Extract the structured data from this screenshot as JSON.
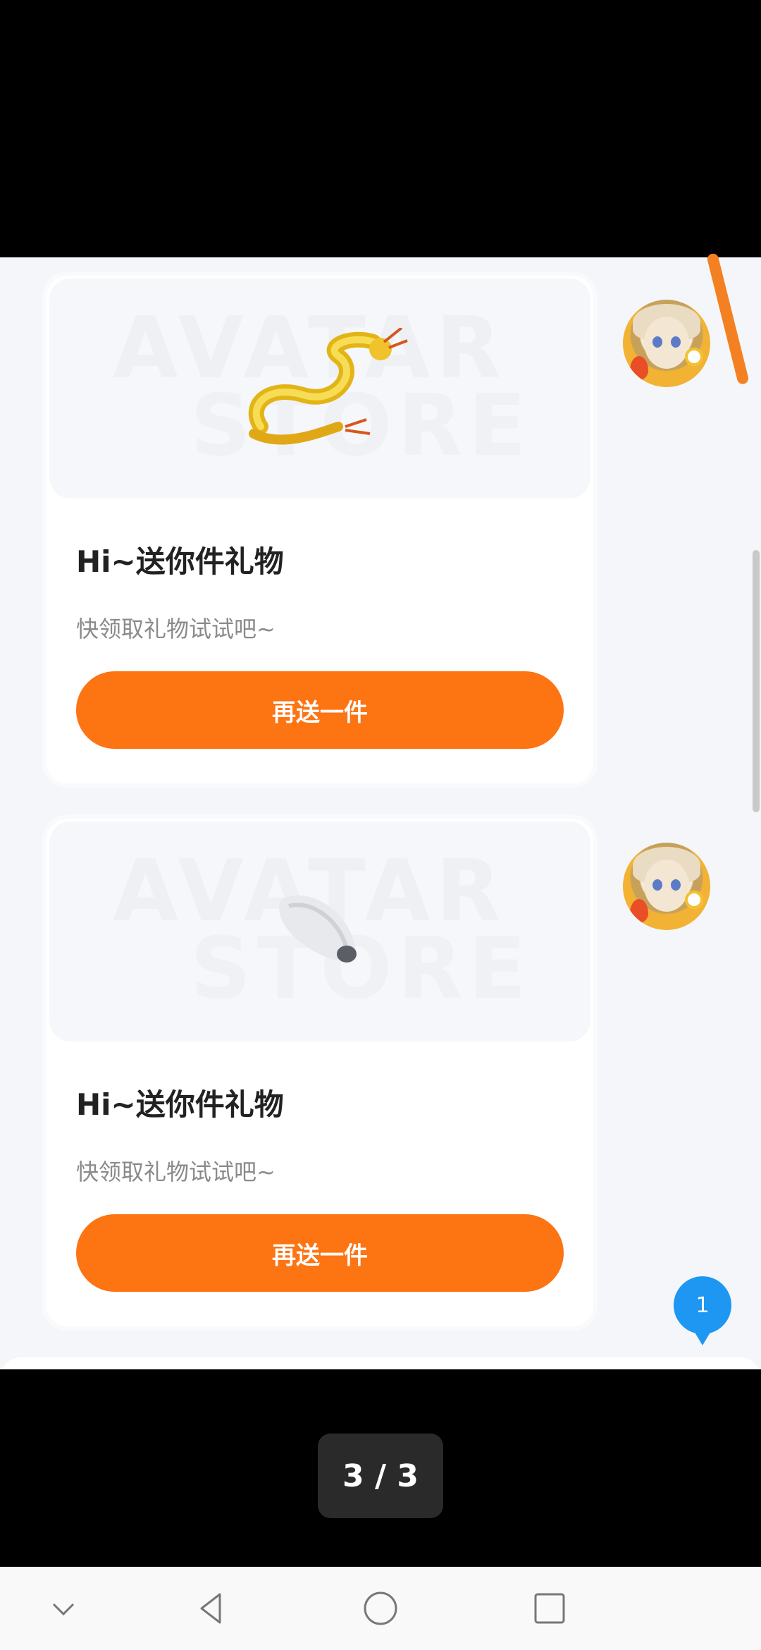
{
  "cards": [
    {
      "image": "golden-dragon",
      "watermark_line1": "AVATAR",
      "watermark_line2": "STORE",
      "title": "Hi~送你件礼物",
      "subtitle": "快领取礼物试试吧~",
      "button_label": "再送一件"
    },
    {
      "image": "fur-tail",
      "watermark_line1": "AVATAR",
      "watermark_line2": "STORE",
      "title": "Hi~送你件礼物",
      "subtitle": "快领取礼物试试吧~",
      "button_label": "再送一件"
    }
  ],
  "unread_badge": "1",
  "page_indicator": "3 / 3",
  "navigation": {
    "icons": [
      "chevron-down-icon",
      "back-triangle-icon",
      "home-circle-icon",
      "recents-square-icon"
    ]
  },
  "colors": {
    "accent": "#fd7413",
    "badge": "#1e97f3"
  }
}
